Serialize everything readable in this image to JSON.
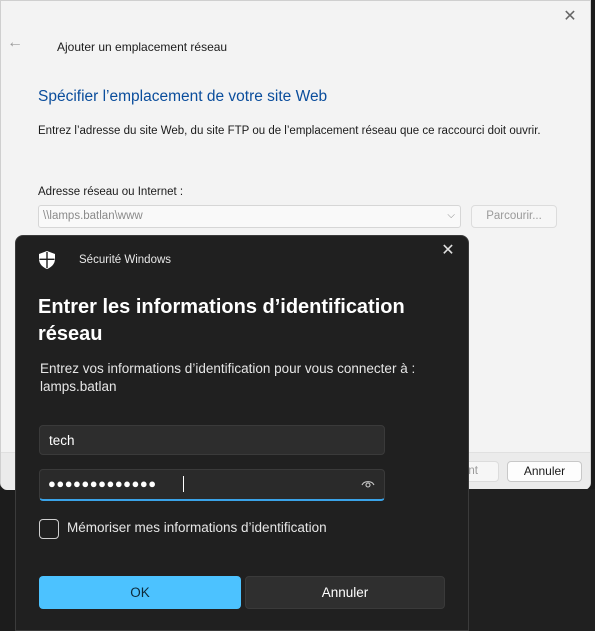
{
  "wizard": {
    "title": "Ajouter un emplacement réseau",
    "heading": "Spécifier l’emplacement de votre site Web",
    "description": "Entrez l’adresse du site Web, du site FTP ou de l’emplacement réseau que ce raccourci doit ouvrir.",
    "address_label": "Adresse réseau ou Internet :",
    "address_value": "\\\\lamps.batlan\\www",
    "browse_label": "Parcourir...",
    "next_label_partial": "nt",
    "cancel_label": "Annuler",
    "close_glyph": "✕",
    "back_glyph": "←",
    "dropdown_glyph": "⌵"
  },
  "security": {
    "app_name": "Sécurité Windows",
    "title": "Entrer les informations d’identification réseau",
    "description": "Entrez vos informations d’identification pour vous connecter à :",
    "host": "lamps.batlan",
    "username_value": "tech",
    "password_mask": "●●●●●●●●●●●●●",
    "remember_label": "Mémoriser mes informations d’identification",
    "remember_checked": false,
    "ok_label": "OK",
    "cancel_label": "Annuler",
    "close_glyph": "✕",
    "colors": {
      "accent": "#4cc2ff",
      "focus_underline": "#3aa3e8",
      "dialog_bg": "#202020"
    }
  }
}
